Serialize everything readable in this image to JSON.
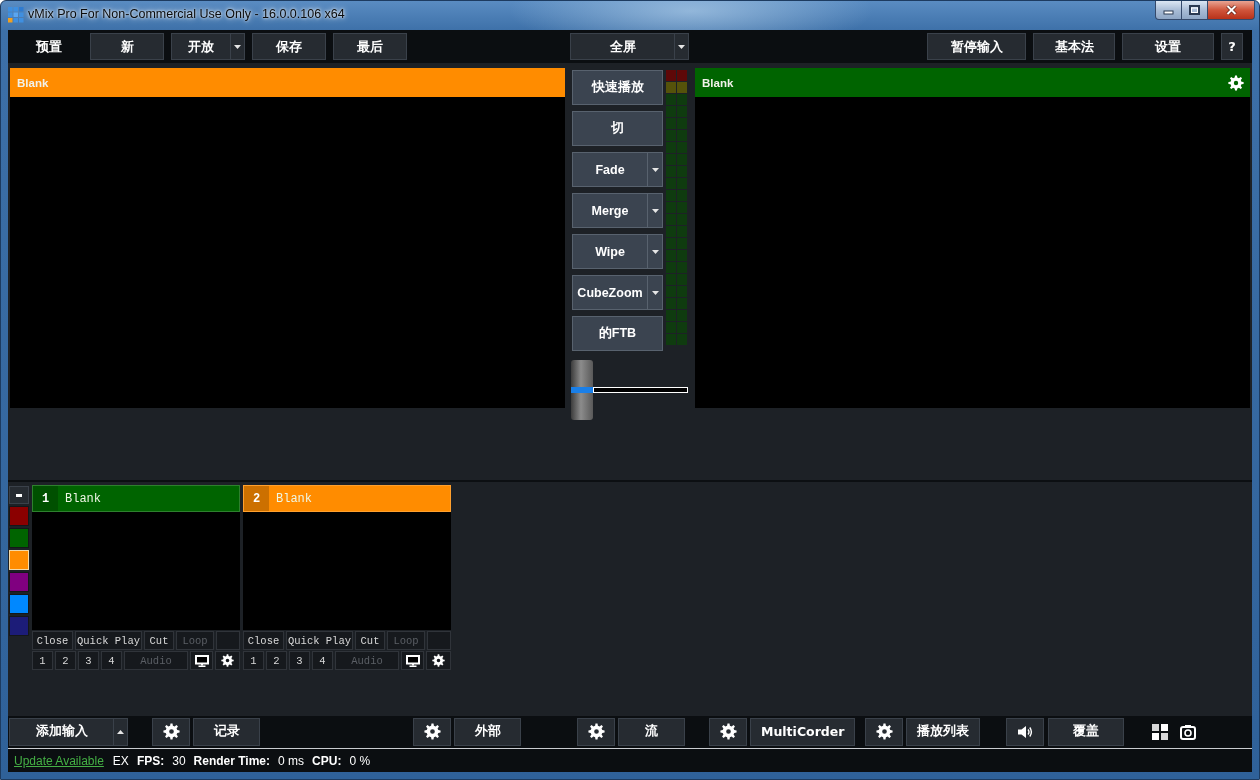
{
  "window": {
    "title": "vMix Pro For Non-Commercial Use Only - 16.0.0.106 x64"
  },
  "toolbar": {
    "label": "预置",
    "left_buttons": [
      {
        "label": "新",
        "dropdown": false
      },
      {
        "label": "开放",
        "dropdown": true
      },
      {
        "label": "保存",
        "dropdown": false
      },
      {
        "label": "最后",
        "dropdown": false
      }
    ],
    "fullscreen": {
      "label": "全屏",
      "dropdown": true
    },
    "right_buttons": [
      {
        "label": "暂停输入"
      },
      {
        "label": "基本法"
      },
      {
        "label": "设置"
      },
      {
        "label": "?"
      }
    ]
  },
  "monitors": [
    {
      "kind": "preview",
      "title": "Blank"
    },
    {
      "kind": "output",
      "title": "Blank"
    }
  ],
  "transitions": [
    {
      "label": "快速播放",
      "dropdown": false
    },
    {
      "label": "切",
      "dropdown": false
    },
    {
      "label": "Fade",
      "dropdown": true
    },
    {
      "label": "Merge",
      "dropdown": true
    },
    {
      "label": "Wipe",
      "dropdown": true
    },
    {
      "label": "CubeZoom",
      "dropdown": true
    },
    {
      "label": "的FTB",
      "dropdown": false
    }
  ],
  "progress_bar": {
    "level": 0
  },
  "color_tags": [
    {
      "color": "#8b0000",
      "selected": false
    },
    {
      "color": "#006400",
      "selected": false
    },
    {
      "color": "#ff8c00",
      "selected": true
    },
    {
      "color": "#800080",
      "selected": false
    },
    {
      "color": "#0088ff",
      "selected": false
    },
    {
      "color": "#1c1c78",
      "selected": false
    }
  ],
  "inputs": [
    {
      "number": "1",
      "title": "Blank",
      "color": "#006400",
      "controls": [
        {
          "label": "Close",
          "disabled": false
        },
        {
          "label": "Quick Play",
          "disabled": false
        },
        {
          "label": "Cut",
          "disabled": false
        },
        {
          "label": "Loop",
          "disabled": true
        }
      ],
      "overlays": [
        "1",
        "2",
        "3",
        "4"
      ],
      "audio": {
        "label": "Audio",
        "disabled": true
      }
    },
    {
      "number": "2",
      "title": "Blank",
      "color": "#ff8c00",
      "controls": [
        {
          "label": "Close",
          "disabled": false
        },
        {
          "label": "Quick Play",
          "disabled": false
        },
        {
          "label": "Cut",
          "disabled": false
        },
        {
          "label": "Loop",
          "disabled": true
        }
      ],
      "overlays": [
        "1",
        "2",
        "3",
        "4"
      ],
      "audio": {
        "label": "Audio",
        "disabled": true
      }
    }
  ],
  "bottom_bar": {
    "add_input": "添加输入",
    "outputs": [
      {
        "label": "记录"
      },
      {
        "label": "外部"
      },
      {
        "label": "流"
      },
      {
        "label": "MultiCorder"
      },
      {
        "label": "播放列表"
      }
    ],
    "overlay": "覆盖"
  },
  "status_bar": {
    "link": "Update Available",
    "mode": "EX",
    "stats": [
      {
        "label": "FPS:",
        "value": "30"
      },
      {
        "label": "Render Time:",
        "value": "0 ms"
      },
      {
        "label": "CPU:",
        "value": "0 %"
      }
    ]
  }
}
